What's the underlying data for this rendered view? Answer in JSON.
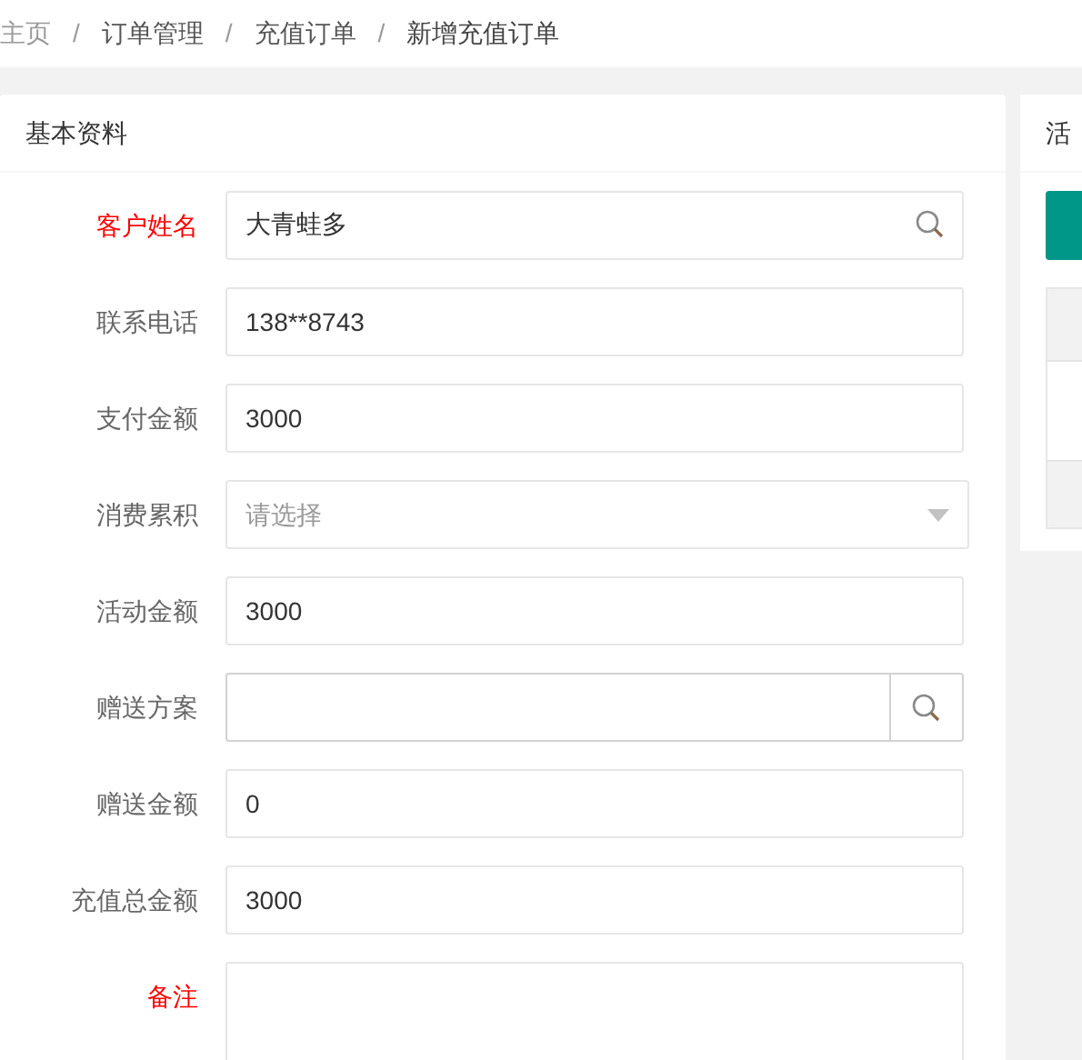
{
  "breadcrumb": [
    {
      "label": "主页",
      "current": false
    },
    {
      "separator": "/",
      "label": "订单管理",
      "current": false
    },
    {
      "separator": "/",
      "label": "充值订单",
      "current": false
    },
    {
      "separator": "/",
      "label": "新增充值订单",
      "current": true
    }
  ],
  "form": {
    "title": "基本资料",
    "fields": [
      {
        "label": "客户姓名",
        "required": true,
        "kind": "search",
        "value": "大青蛙多"
      },
      {
        "label": "联系电话",
        "required": false,
        "kind": "text",
        "value": "138**8743"
      },
      {
        "label": "支付金额",
        "required": false,
        "kind": "text",
        "value": "3000"
      },
      {
        "label": "消费累积",
        "required": false,
        "kind": "select",
        "placeholder": "请选择"
      },
      {
        "label": "活动金额",
        "required": false,
        "kind": "text",
        "value": "3000"
      },
      {
        "label": "赠送方案",
        "required": false,
        "kind": "search-button"
      },
      {
        "label": "赠送金额",
        "required": false,
        "kind": "text",
        "value": "0"
      },
      {
        "label": "充值总金额",
        "required": false,
        "kind": "text",
        "value": "3000"
      },
      {
        "label": "备注",
        "required": true,
        "kind": "textarea"
      }
    ]
  },
  "side_panel": {
    "title": "活"
  }
}
